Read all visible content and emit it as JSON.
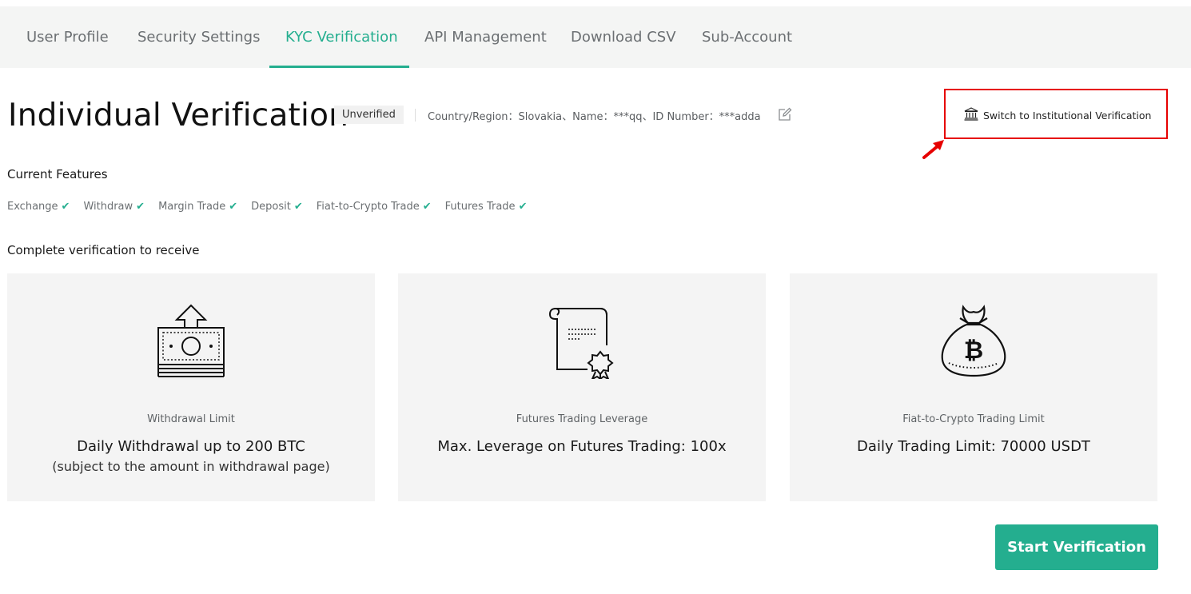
{
  "tabs": [
    {
      "label": "User Profile"
    },
    {
      "label": "Security Settings"
    },
    {
      "label": "KYC Verification",
      "active": true
    },
    {
      "label": "API Management"
    },
    {
      "label": "Download CSV"
    },
    {
      "label": "Sub-Account"
    }
  ],
  "header": {
    "title": "Individual Verification",
    "status_badge": "Unverified",
    "info": "Country/Region：Slovakia、Name：***qq、ID Number：***adda",
    "switch_label": "Switch to Institutional Verification"
  },
  "current_features": {
    "heading": "Current Features",
    "items": [
      "Exchange",
      "Withdraw",
      "Margin Trade",
      "Deposit",
      "Fiat-to-Crypto Trade",
      "Futures Trade"
    ]
  },
  "receive": {
    "heading": "Complete verification to receive",
    "cards": [
      {
        "icon": "cash-upload-icon",
        "caption": "Withdrawal Limit",
        "main": "Daily Withdrawal up to 200 BTC",
        "sub": "(subject to the amount in withdrawal page)"
      },
      {
        "icon": "certificate-icon",
        "caption": "Futures Trading Leverage",
        "main": "Max. Leverage on Futures Trading: 100x",
        "sub": ""
      },
      {
        "icon": "bitcoin-bag-icon",
        "caption": "Fiat-to-Crypto Trading Limit",
        "main": "Daily Trading Limit: 70000 USDT",
        "sub": ""
      }
    ]
  },
  "actions": {
    "start_label": "Start Verification"
  },
  "colors": {
    "accent": "#24ae8f",
    "annotation": "#e60000",
    "card_bg": "#f4f4f4"
  }
}
